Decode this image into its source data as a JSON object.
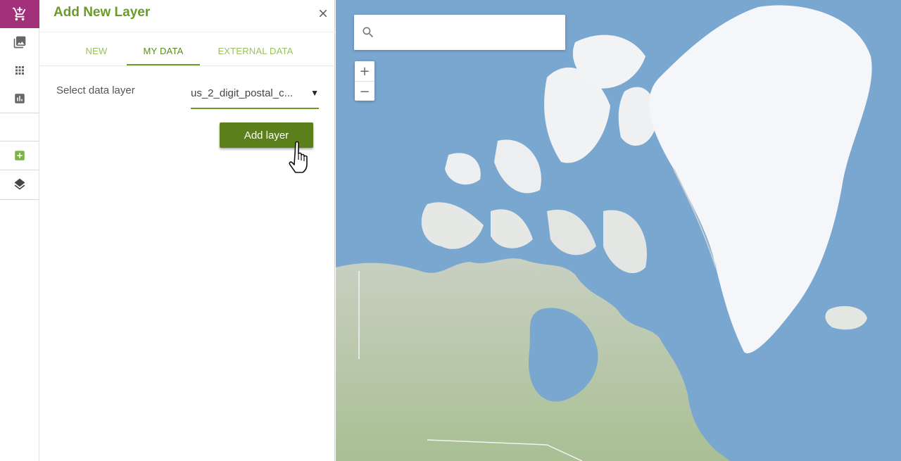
{
  "rail": {
    "icons": [
      "add-to-cart-icon",
      "image-gallery-icon",
      "apps-grid-icon",
      "bar-chart-icon",
      "add-box-icon",
      "layers-icon"
    ],
    "active_color": "#a3317a"
  },
  "panel": {
    "title": "Add New Layer",
    "tabs": [
      {
        "label": "NEW"
      },
      {
        "label": "MY DATA"
      },
      {
        "label": "EXTERNAL DATA"
      }
    ],
    "active_tab": "MY DATA",
    "select_label": "Select data layer",
    "select_value": "us_2_digit_postal_c...",
    "add_button_label": "Add layer",
    "accent_color": "#6b9a2a",
    "button_color": "#5b7f1b"
  },
  "map": {
    "search_placeholder": "",
    "zoom_in_label": "+",
    "zoom_out_label": "−",
    "colors": {
      "ocean": "#7aa7cf",
      "ice": "#f3f5f8",
      "land": "#c9cfc0",
      "forest": "#9fb78f"
    }
  }
}
